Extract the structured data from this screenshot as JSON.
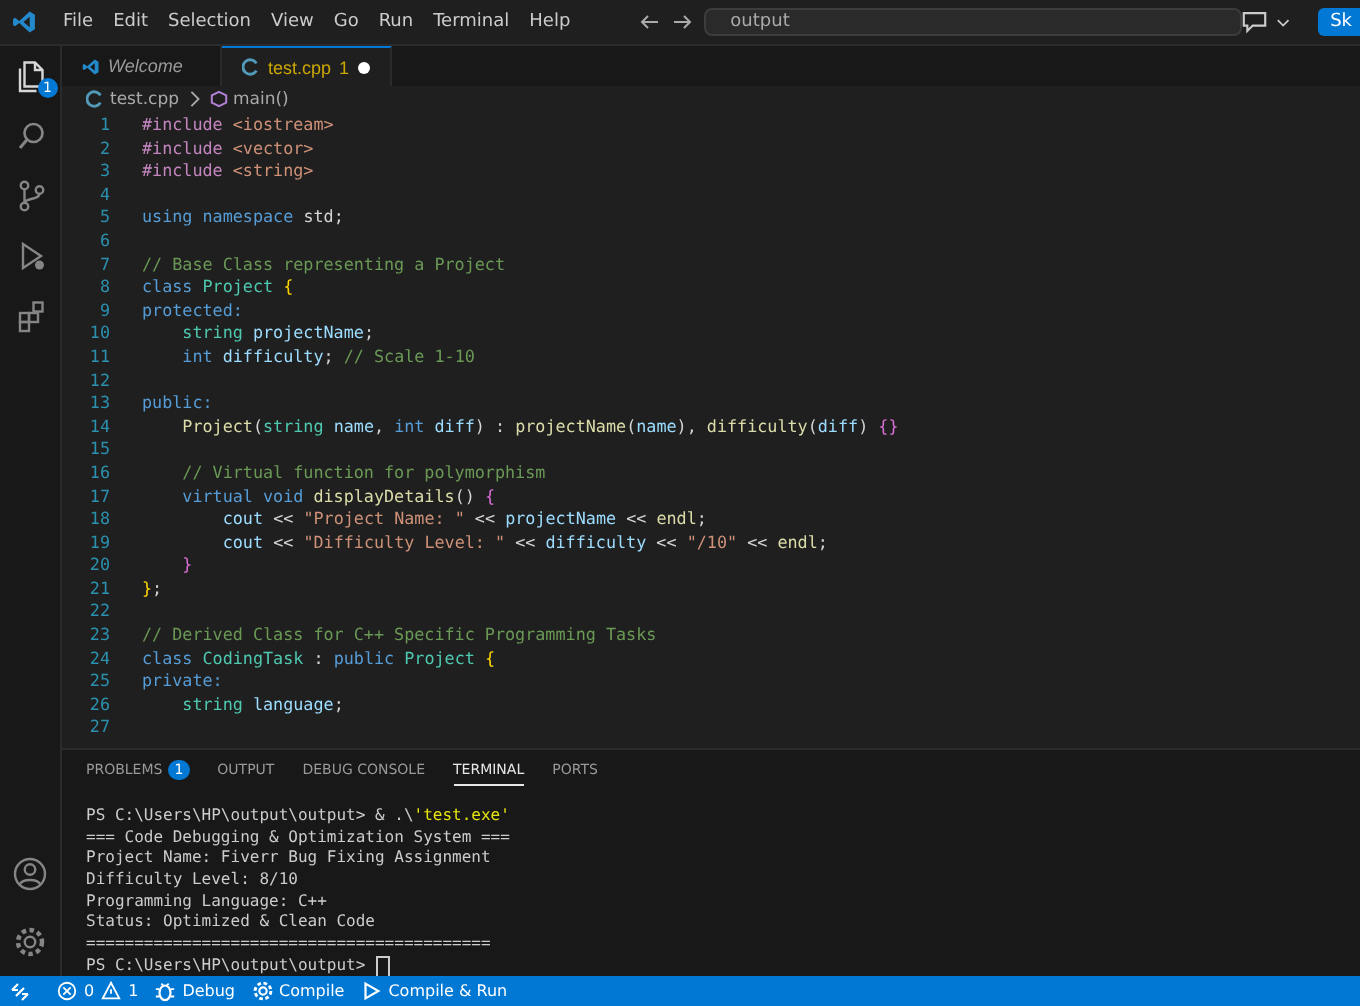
{
  "menu": [
    "File",
    "Edit",
    "Selection",
    "View",
    "Go",
    "Run",
    "Terminal",
    "Help"
  ],
  "search": {
    "value": "output"
  },
  "account_button": "Sk",
  "activity": [
    {
      "kind": "files",
      "badge": "1",
      "selected": true
    },
    {
      "kind": "search",
      "selected": false
    },
    {
      "kind": "scm",
      "selected": false
    },
    {
      "kind": "debug",
      "selected": false
    },
    {
      "kind": "extensions",
      "selected": false
    }
  ],
  "tabs": [
    {
      "label": "Welcome",
      "kind": "welcome",
      "selected": false
    },
    {
      "label": "test.cpp",
      "kind": "cpp",
      "selected": true,
      "problems": "1",
      "modified": true
    }
  ],
  "breadcrumb": [
    "test.cpp",
    "main()"
  ],
  "code": [
    {
      "number": "1",
      "tokens": [
        {
          "kind": "pre",
          "text": "#include "
        },
        {
          "kind": "str",
          "text": "<iostream>"
        }
      ]
    },
    {
      "number": "2",
      "tokens": [
        {
          "kind": "pre",
          "text": "#include "
        },
        {
          "kind": "str",
          "text": "<vector>"
        }
      ]
    },
    {
      "number": "3",
      "tokens": [
        {
          "kind": "pre",
          "text": "#include "
        },
        {
          "kind": "str",
          "text": "<string>"
        }
      ]
    },
    {
      "number": "4"
    },
    {
      "number": "5",
      "tokens": [
        {
          "kind": "kw",
          "text": "using namespace "
        },
        {
          "kind": "plain",
          "text": "std;"
        }
      ]
    },
    {
      "number": "6"
    },
    {
      "number": "7",
      "tokens": [
        {
          "kind": "comment",
          "text": "// Base Class representing a Project"
        }
      ]
    },
    {
      "number": "8",
      "tokens": [
        {
          "kind": "kw",
          "text": "class "
        },
        {
          "kind": "type",
          "text": "Project "
        },
        {
          "kind": "brace",
          "text": "{"
        }
      ]
    },
    {
      "number": "9",
      "tokens": [
        {
          "kind": "kw",
          "text": "protected:"
        }
      ]
    },
    {
      "number": "10",
      "tokens": [
        {
          "kind": "type",
          "text": "    string "
        },
        {
          "kind": "var",
          "text": "projectName"
        },
        {
          "kind": "plain",
          "text": ";"
        }
      ]
    },
    {
      "number": "11",
      "tokens": [
        {
          "kind": "kw",
          "text": "    int "
        },
        {
          "kind": "var",
          "text": "difficulty"
        },
        {
          "kind": "plain",
          "text": "; "
        },
        {
          "kind": "comment",
          "text": "// Scale 1-10"
        }
      ]
    },
    {
      "number": "12"
    },
    {
      "number": "13",
      "tokens": [
        {
          "kind": "kw",
          "text": "public:"
        }
      ]
    },
    {
      "number": "14",
      "tokens": [
        {
          "kind": "func",
          "text": "    Project"
        },
        {
          "kind": "plain",
          "text": "("
        },
        {
          "kind": "type",
          "text": "string "
        },
        {
          "kind": "var",
          "text": "name"
        },
        {
          "kind": "plain",
          "text": ", "
        },
        {
          "kind": "kw",
          "text": "int "
        },
        {
          "kind": "var",
          "text": "diff"
        },
        {
          "kind": "plain",
          "text": ") : "
        },
        {
          "kind": "func",
          "text": "projectName"
        },
        {
          "kind": "plain",
          "text": "("
        },
        {
          "kind": "var",
          "text": "name"
        },
        {
          "kind": "plain",
          "text": "), "
        },
        {
          "kind": "func",
          "text": "difficulty"
        },
        {
          "kind": "plain",
          "text": "("
        },
        {
          "kind": "var",
          "text": "diff"
        },
        {
          "kind": "plain",
          "text": ") "
        },
        {
          "kind": "brace2",
          "text": "{}"
        }
      ]
    },
    {
      "number": "15"
    },
    {
      "number": "16",
      "tokens": [
        {
          "kind": "comment",
          "text": "    // Virtual function for polymorphism"
        }
      ]
    },
    {
      "number": "17",
      "tokens": [
        {
          "kind": "kw",
          "text": "    virtual void "
        },
        {
          "kind": "func",
          "text": "displayDetails"
        },
        {
          "kind": "plain",
          "text": "() "
        },
        {
          "kind": "brace2",
          "text": "{"
        }
      ]
    },
    {
      "number": "18",
      "tokens": [
        {
          "kind": "var",
          "text": "        cout "
        },
        {
          "kind": "plain",
          "text": "<< "
        },
        {
          "kind": "str",
          "text": "\"Project Name: \""
        },
        {
          "kind": "plain",
          "text": " << "
        },
        {
          "kind": "var",
          "text": "projectName"
        },
        {
          "kind": "plain",
          "text": " << "
        },
        {
          "kind": "func",
          "text": "endl"
        },
        {
          "kind": "plain",
          "text": ";"
        }
      ]
    },
    {
      "number": "19",
      "tokens": [
        {
          "kind": "var",
          "text": "        cout "
        },
        {
          "kind": "plain",
          "text": "<< "
        },
        {
          "kind": "str",
          "text": "\"Difficulty Level: \""
        },
        {
          "kind": "plain",
          "text": " << "
        },
        {
          "kind": "var",
          "text": "difficulty"
        },
        {
          "kind": "plain",
          "text": " << "
        },
        {
          "kind": "str",
          "text": "\"/10\""
        },
        {
          "kind": "plain",
          "text": " << "
        },
        {
          "kind": "func",
          "text": "endl"
        },
        {
          "kind": "plain",
          "text": ";"
        }
      ]
    },
    {
      "number": "20",
      "tokens": [
        {
          "kind": "brace2",
          "text": "    }"
        }
      ]
    },
    {
      "number": "21",
      "tokens": [
        {
          "kind": "brace",
          "text": "}"
        },
        {
          "kind": "plain",
          "text": ";"
        }
      ]
    },
    {
      "number": "22"
    },
    {
      "number": "23",
      "tokens": [
        {
          "kind": "comment",
          "text": "// Derived Class for C++ Specific Programming Tasks"
        }
      ]
    },
    {
      "number": "24",
      "tokens": [
        {
          "kind": "kw",
          "text": "class "
        },
        {
          "kind": "type",
          "text": "CodingTask "
        },
        {
          "kind": "plain",
          "text": ": "
        },
        {
          "kind": "kw",
          "text": "public "
        },
        {
          "kind": "type",
          "text": "Project "
        },
        {
          "kind": "brace",
          "text": "{"
        }
      ]
    },
    {
      "number": "25",
      "tokens": [
        {
          "kind": "kw",
          "text": "private:"
        }
      ]
    },
    {
      "number": "26",
      "tokens": [
        {
          "kind": "type",
          "text": "    string "
        },
        {
          "kind": "var",
          "text": "language"
        },
        {
          "kind": "plain",
          "text": ";"
        }
      ]
    },
    {
      "number": "27"
    }
  ],
  "panel_tabs": [
    {
      "label": "PROBLEMS",
      "badge": "1",
      "selected": false
    },
    {
      "label": "OUTPUT",
      "selected": false
    },
    {
      "label": "DEBUG CONSOLE",
      "selected": false
    },
    {
      "label": "TERMINAL",
      "selected": true
    },
    {
      "label": "PORTS",
      "selected": false
    }
  ],
  "terminal": [
    {
      "tokens": [
        {
          "kind": "plain",
          "text": "PS C:\\Users\\HP\\output\\output> & .\\"
        },
        {
          "kind": "str",
          "text": "'test.exe'"
        }
      ]
    },
    {
      "tokens": [
        {
          "kind": "plain",
          "text": "=== Code Debugging & Optimization System ==="
        }
      ]
    },
    {
      "tokens": [
        {
          "kind": "plain",
          "text": "Project Name: Fiverr Bug Fixing Assignment"
        }
      ]
    },
    {
      "tokens": [
        {
          "kind": "plain",
          "text": "Difficulty Level: 8/10"
        }
      ]
    },
    {
      "tokens": [
        {
          "kind": "plain",
          "text": "Programming Language: C++"
        }
      ]
    },
    {
      "tokens": [
        {
          "kind": "plain",
          "text": "Status: Optimized & Clean Code"
        }
      ]
    },
    {
      "tokens": [
        {
          "kind": "plain",
          "text": "=========================================="
        }
      ]
    },
    {
      "tokens": [
        {
          "kind": "plain",
          "text": "PS C:\\Users\\HP\\output\\output> "
        }
      ],
      "cursor": true
    }
  ],
  "status": {
    "errors": "0",
    "warnings": "1",
    "items": [
      {
        "kind": "debug",
        "label": "Debug"
      },
      {
        "kind": "gear",
        "label": "Compile"
      },
      {
        "kind": "play",
        "label": "Compile & Run"
      }
    ]
  }
}
